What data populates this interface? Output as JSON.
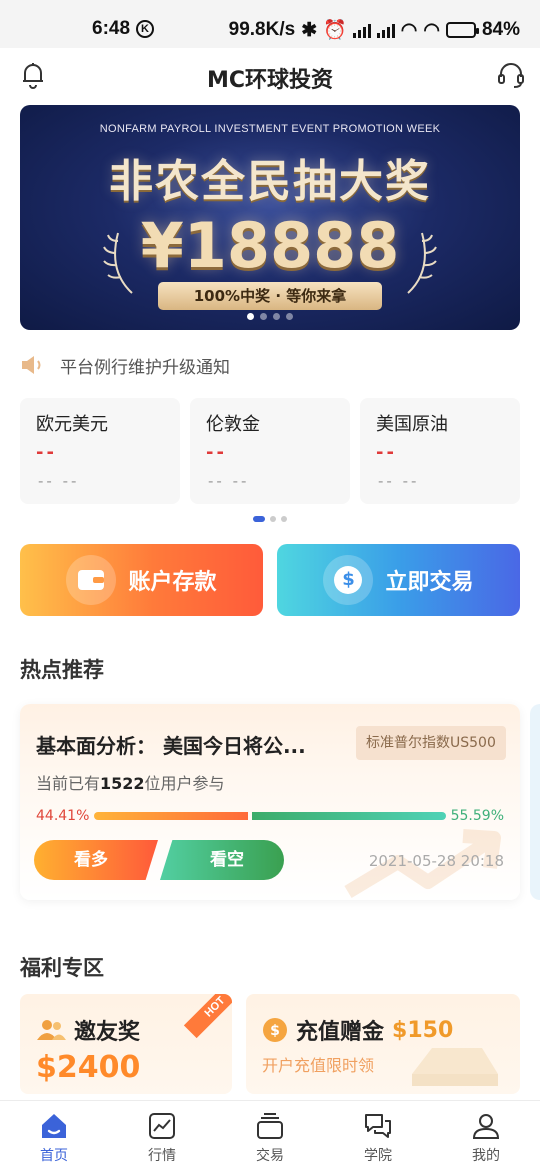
{
  "status_bar": {
    "time": "6:48",
    "k_badge": "K",
    "net_speed": "99.8K/s",
    "battery": "84%",
    "battery_level": 0.84
  },
  "header": {
    "title": "MC环球投资"
  },
  "banner": {
    "subtitle": "NONFARM PAYROLL INVESTMENT EVENT PROMOTION WEEK",
    "headline": "非农全民抽大奖",
    "amount": "¥18888",
    "pill": "100%中奖 · 等你来拿",
    "active_dot": 0,
    "dot_count": 4
  },
  "notice": {
    "text": "平台例行维护升级通知"
  },
  "quotes": [
    {
      "name": "欧元美元",
      "price": "--",
      "change": "-- --"
    },
    {
      "name": "伦敦金",
      "price": "--",
      "change": "-- --"
    },
    {
      "name": "美国原油",
      "price": "--",
      "change": "-- --"
    }
  ],
  "actions": {
    "deposit_label": "账户存款",
    "trade_label": "立即交易",
    "trade_symbol": "$"
  },
  "hot": {
    "section_title": "热点推荐",
    "title": "基本面分析：  美国今日将公...",
    "tag": "标准普尔指数US500",
    "participants_prefix": "当前已有",
    "participants_count": "1522",
    "participants_suffix": "位用户参与",
    "long_pct": "44.41%",
    "short_pct": "55.59%",
    "long_label": "看多",
    "short_label": "看空",
    "datetime": "2021-05-28 20:18"
  },
  "welfare": {
    "section_title": "福利专区",
    "invite_title": "邀友奖",
    "invite_amount": "$2400",
    "hot_badge": "HOT",
    "recharge_title": "充值赠金",
    "recharge_amount": "$150",
    "recharge_sub": "开户充值限时领"
  },
  "tabbar": [
    {
      "label": "首页",
      "icon": "home-icon",
      "active": true
    },
    {
      "label": "行情",
      "icon": "chart-icon",
      "active": false
    },
    {
      "label": "交易",
      "icon": "trade-stack-icon",
      "active": false
    },
    {
      "label": "学院",
      "icon": "chat-bubbles-icon",
      "active": false
    },
    {
      "label": "我的",
      "icon": "user-icon",
      "active": false
    }
  ],
  "colors": {
    "accent": "#3b63d9",
    "up_red": "#e03a3a",
    "down_green": "#3fb07a",
    "orange": "#ff8a2a"
  }
}
